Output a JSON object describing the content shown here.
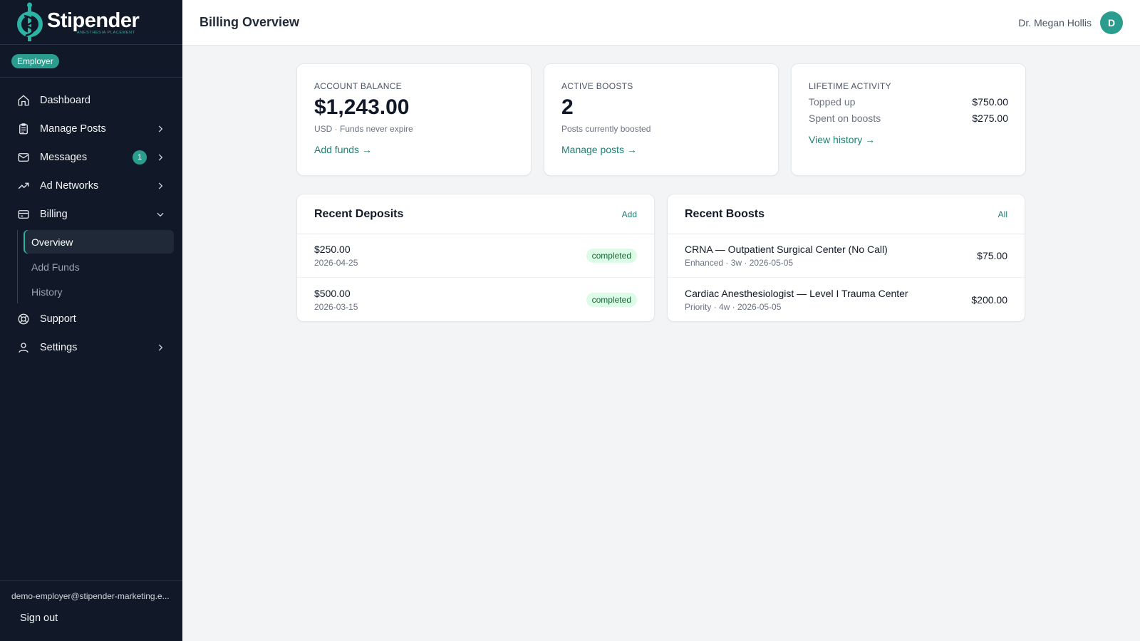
{
  "app": {
    "name": "Stipender",
    "tagline": "ANESTHESIA PLACEMENT",
    "role": "Employer"
  },
  "sidebar": {
    "items": [
      {
        "label": "Dashboard",
        "icon": "home-icon"
      },
      {
        "label": "Manage Posts",
        "icon": "clipboard-icon"
      },
      {
        "label": "Messages",
        "icon": "mail-icon",
        "badge": "1"
      },
      {
        "label": "Ad Networks",
        "icon": "trending-up-icon"
      },
      {
        "label": "Billing",
        "icon": "credit-card-icon"
      },
      {
        "label": "Support",
        "icon": "lifebuoy-icon"
      },
      {
        "label": "Settings",
        "icon": "user-icon"
      }
    ],
    "billing_sub": [
      "Overview",
      "Add Funds",
      "History"
    ],
    "active_sub": "Overview",
    "email": "demo-employer@stipender-marketing.e...",
    "sign_out": "Sign out"
  },
  "header": {
    "title": "Billing Overview",
    "user_name": "Dr. Megan Hollis",
    "avatar_initial": "D"
  },
  "stats": {
    "balance": {
      "label": "ACCOUNT BALANCE",
      "value": "$1,243.00",
      "sub": "USD · Funds never expire",
      "link": "Add funds →"
    },
    "boosts": {
      "label": "ACTIVE BOOSTS",
      "value": "2",
      "sub": "Posts currently boosted",
      "link": "Manage posts →"
    },
    "lifetime": {
      "label": "LIFETIME ACTIVITY",
      "rows": [
        {
          "k": "Topped up",
          "v": "$750.00"
        },
        {
          "k": "Spent on boosts",
          "v": "$275.00"
        }
      ],
      "link": "View history →"
    }
  },
  "deposits": {
    "title": "Recent Deposits",
    "action": "Add",
    "items": [
      {
        "amount": "$250.00",
        "date": "2026-04-25",
        "status": "completed"
      },
      {
        "amount": "$500.00",
        "date": "2026-03-15",
        "status": "completed"
      }
    ]
  },
  "boosts": {
    "title": "Recent Boosts",
    "action": "All",
    "items": [
      {
        "title": "CRNA — Outpatient Surgical Center (No Call)",
        "meta": "Enhanced · 3w · 2026-05-05",
        "amount": "$75.00"
      },
      {
        "title": "Cardiac Anesthesiologist — Level I Trauma Center",
        "meta": "Priority · 4w · 2026-05-05",
        "amount": "$200.00"
      }
    ]
  },
  "colors": {
    "sidebar_bg": "#111827",
    "accent": "#2a9d8f",
    "link": "#1f7f73",
    "status_completed_bg": "#dcfce7",
    "status_completed_fg": "#166534"
  }
}
